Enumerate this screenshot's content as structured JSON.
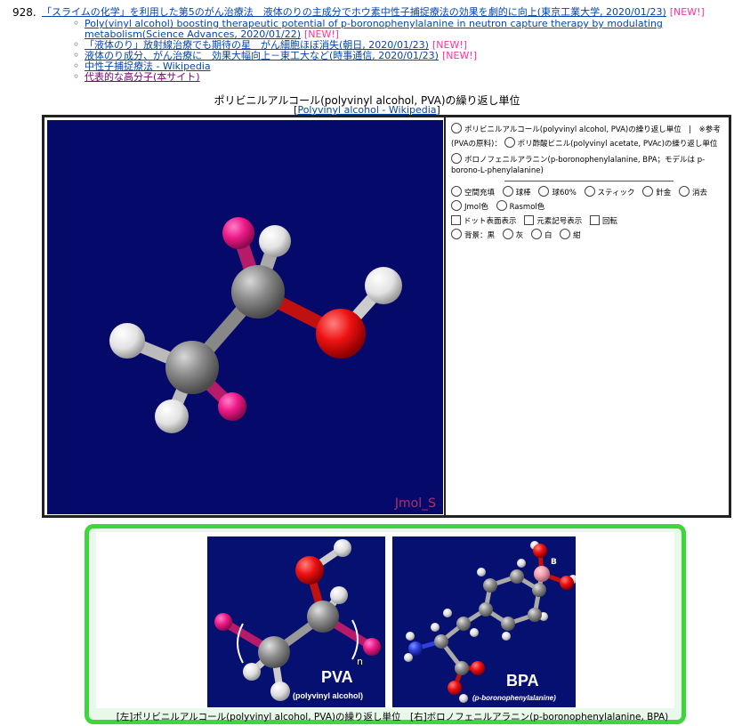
{
  "news": {
    "number": "928.",
    "headline": "「スライムの化学」を利用した第5のがん治療法　液体のりの主成分でホウ素中性子捕捉療法の効果を劇的に向上(東京工業大学, 2020/01/23)",
    "headline_new": "[NEW!]",
    "items": [
      {
        "text": "Poly(vinyl alcohol) boosting therapeutic potential of p-boronophenylalanine in neutron capture therapy by modulating metabolism(Science Advances, 2020/01/22)",
        "new": "[NEW!]"
      },
      {
        "text": "「液体のり」放射線治療でも期待の星　がん細胞ほぼ消失(朝日, 2020/01/23)",
        "new": "[NEW!]"
      },
      {
        "text": "液体のり成分、がん治療に　効果大幅向上－東工大など(時事通信, 2020/01/23)",
        "new": "[NEW!]"
      },
      {
        "text": "中性子捕捉療法 - Wikipedia",
        "new": ""
      },
      {
        "text": "代表的な高分子(本サイト)",
        "new": ""
      }
    ]
  },
  "caption": {
    "title": "ポリビニルアルコール(polyvinyl alcohol, PVA)の繰り返し単位",
    "link": "Polyvinyl alcohol - Wikipedia"
  },
  "viewer": {
    "watermark": "Jmol_S"
  },
  "controls": {
    "model_pva": "ポリビニルアルコール(polyvinyl alcohol, PVA)の繰り返し単位　|　※参考(PVAの原料)：",
    "model_pvac": "ポリ酢酸ビニル(polyvinyl acetate, PVAc)の繰り返し単位",
    "model_bpa": "ボロノフェニルアラニン(p-boronophenylalanine, BPA；モデルは p-borono-L-phenylalanine)",
    "styles": [
      "空間充填",
      "球棒",
      "球60%",
      "スティック",
      "針金",
      "消去"
    ],
    "colors": [
      "Jmol色",
      "Rasmol色"
    ],
    "toggles": [
      "ドット表面表示",
      "元素記号表示",
      "回転"
    ],
    "backgrounds": [
      "背景：黒",
      "灰",
      "白",
      "紺"
    ]
  },
  "figure": {
    "pva_label": "PVA",
    "pva_sub": "(polyvinyl alcohol)",
    "pva_n": "n",
    "bpa_label": "BPA",
    "bpa_sub": "(p-boronophenylalanine)",
    "bpa_b": "B",
    "caption": "[左]ポリビニルアルコール(polyvinyl alcohol, PVA)の繰り返し単位　[右]ボロノフェニルアラニン(p-boronophenylalanine, BPA)"
  }
}
